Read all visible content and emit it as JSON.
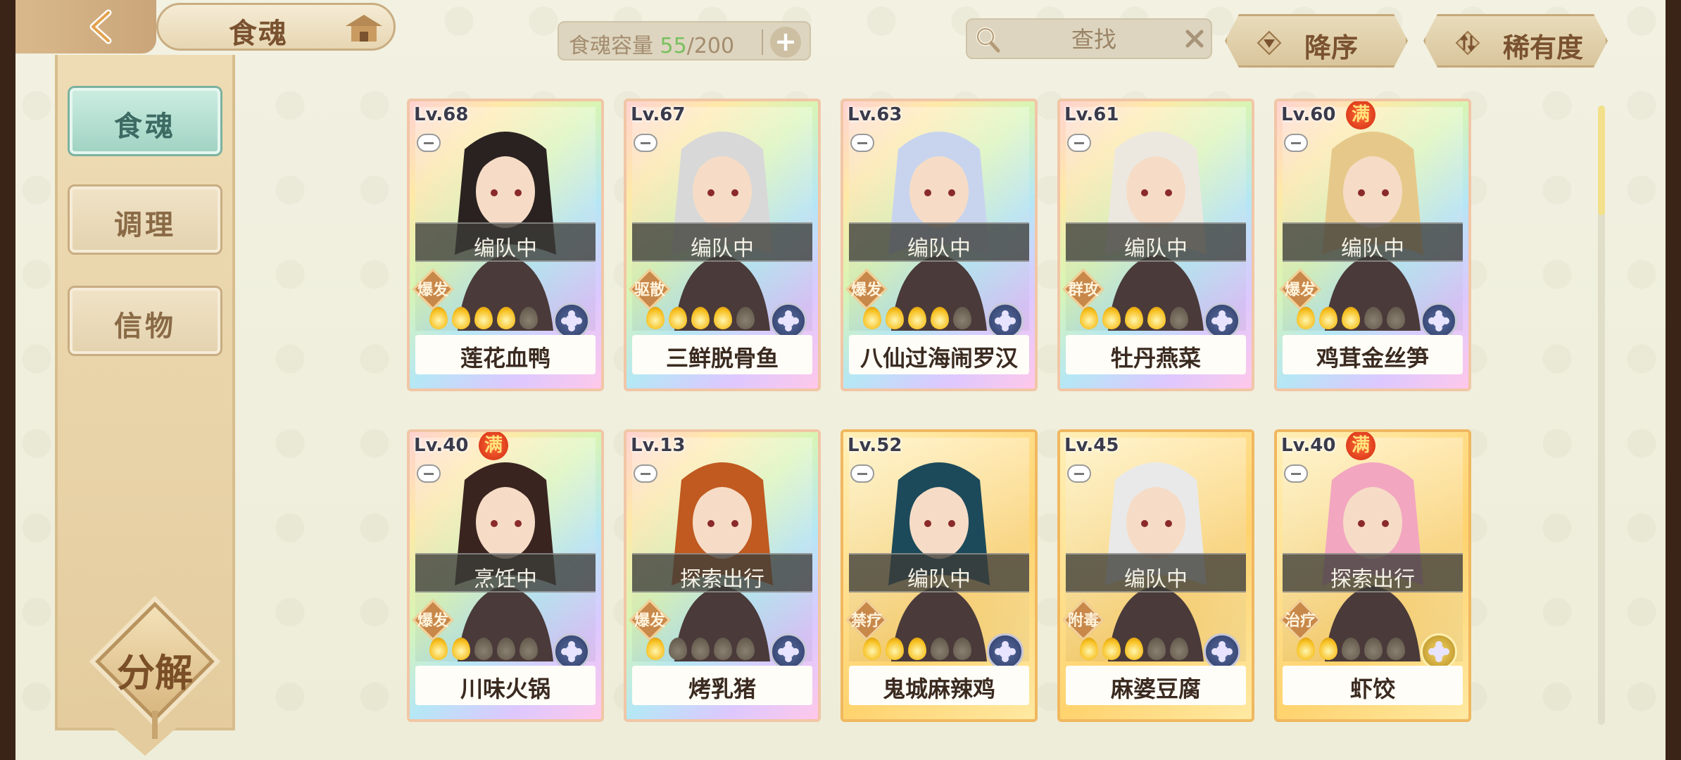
{
  "header": {
    "title": "食魂",
    "capacity_label": "食魂容量",
    "capacity_current": "55",
    "capacity_sep_max": "/200",
    "capacity_add": "+",
    "search_placeholder": "查找",
    "sort_order_label": "降序",
    "sort_rarity_label": "稀有度"
  },
  "sidebar": {
    "tabs": [
      {
        "label": "食魂",
        "active": true
      },
      {
        "label": "调理",
        "active": false
      },
      {
        "label": "信物",
        "active": false
      }
    ],
    "decompose_label": "分解"
  },
  "cards": [
    {
      "level": "Lv.68",
      "name": "莲花血鸭",
      "status": "编队中",
      "role": "爆发",
      "stars": 4,
      "full": false,
      "frame": "rainbow",
      "element": "blue"
    },
    {
      "level": "Lv.67",
      "name": "三鲜脱骨鱼",
      "status": "编队中",
      "role": "驱散",
      "stars": 4,
      "full": false,
      "frame": "rainbow",
      "element": "blue"
    },
    {
      "level": "Lv.63",
      "name": "八仙过海闹罗汉",
      "status": "编队中",
      "role": "爆发",
      "stars": 4,
      "full": false,
      "frame": "rainbow",
      "element": "blue"
    },
    {
      "level": "Lv.61",
      "name": "牡丹燕菜",
      "status": "编队中",
      "role": "群攻",
      "stars": 4,
      "full": false,
      "frame": "rainbow",
      "element": "blue"
    },
    {
      "level": "Lv.60",
      "name": "鸡茸金丝笋",
      "status": "编队中",
      "role": "爆发",
      "stars": 3,
      "full": true,
      "full_label": "满",
      "frame": "rainbow",
      "element": "blue"
    },
    {
      "level": "Lv.40",
      "name": "川味火锅",
      "status": "烹饪中",
      "role": "爆发",
      "stars": 2,
      "full": true,
      "full_label": "满",
      "frame": "rainbow",
      "element": "blue"
    },
    {
      "level": "Lv.13",
      "name": "烤乳猪",
      "status": "探索出行",
      "role": "爆发",
      "stars": 1,
      "full": false,
      "frame": "rainbow",
      "element": "blue"
    },
    {
      "level": "Lv.52",
      "name": "鬼城麻辣鸡",
      "status": "编队中",
      "role": "禁疗",
      "stars": 3,
      "full": false,
      "frame": "gold",
      "element": "blue"
    },
    {
      "level": "Lv.45",
      "name": "麻婆豆腐",
      "status": "编队中",
      "role": "附毒",
      "stars": 3,
      "full": false,
      "frame": "gold",
      "element": "blue"
    },
    {
      "level": "Lv.40",
      "name": "虾饺",
      "status": "探索出行",
      "role": "治疗",
      "stars": 2,
      "full": true,
      "full_label": "满",
      "frame": "gold",
      "element": "gold"
    }
  ],
  "colors": {
    "accent_teal": "#9fd2c2",
    "capacity_green": "#79c060",
    "text_brown": "#7a5230"
  },
  "icons": [
    "back-arrow-icon",
    "house-icon",
    "search-icon",
    "close-icon",
    "sort-down-icon",
    "rarity-icon",
    "minus-icon",
    "element-icon"
  ]
}
